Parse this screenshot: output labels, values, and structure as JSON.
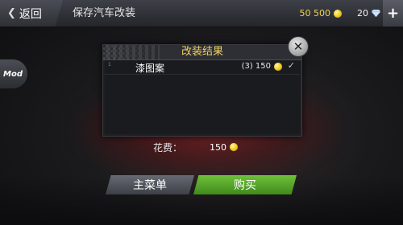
{
  "topbar": {
    "back_label": "返回",
    "title": "保存汽车改装",
    "coins": "50 500",
    "gems": "20",
    "plus_label": "+"
  },
  "side": {
    "mod_label": "Mod"
  },
  "dialog": {
    "title": "改装结果",
    "close_label": "✕",
    "items": [
      {
        "index": "1",
        "label": "漆图案",
        "price": "(3) 150",
        "check": "✓"
      }
    ]
  },
  "cost": {
    "label": "花费：",
    "value": "150"
  },
  "buttons": {
    "main_menu": "主菜单",
    "buy": "购买"
  },
  "colors": {
    "coin": "#f2d34b",
    "buy_button": "#4fa12a",
    "title": "#f0d060"
  }
}
